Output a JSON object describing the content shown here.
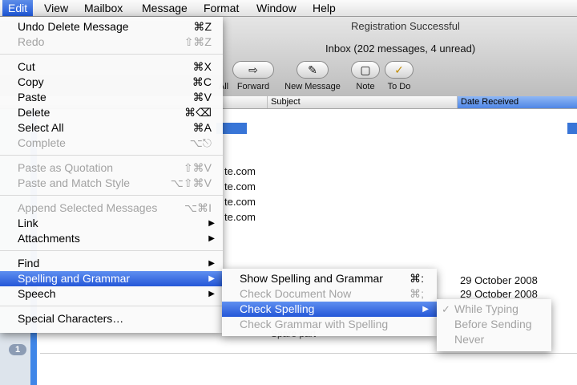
{
  "menubar": {
    "items": [
      "Edit",
      "View",
      "Mailbox",
      "Message",
      "Format",
      "Window",
      "Help"
    ]
  },
  "window": {
    "title": "Registration Successful",
    "subtitle": "Inbox (202 messages, 4 unread)",
    "toolbar": [
      {
        "label": "All",
        "icon": "reply-all-icon"
      },
      {
        "label": "Forward",
        "icon": "forward-arrow-icon",
        "glyph": "⇨"
      },
      {
        "label": "New Message",
        "icon": "compose-icon",
        "glyph": "✎"
      },
      {
        "label": "Note",
        "icon": "note-icon",
        "glyph": "▢"
      },
      {
        "label": "To Do",
        "icon": "checkmark-icon",
        "glyph": "✓"
      }
    ],
    "columns": {
      "subject": "Subject",
      "date": "Date Received"
    },
    "sidebar_badge": "1",
    "fragments": [
      "te.com",
      "te.com",
      "te.com",
      "te.com"
    ],
    "dates": [
      "29 October 2008",
      "29 October 2008"
    ],
    "bottom_fragment": "Spare part"
  },
  "edit_menu": {
    "items": [
      {
        "label": "Undo Delete Message",
        "shortcut": "⌘Z",
        "disabled": false
      },
      {
        "label": "Redo",
        "shortcut": "⇧⌘Z",
        "disabled": true
      },
      {
        "label": "Cut",
        "shortcut": "⌘X",
        "disabled": false
      },
      {
        "label": "Copy",
        "shortcut": "⌘C",
        "disabled": false
      },
      {
        "label": "Paste",
        "shortcut": "⌘V",
        "disabled": false
      },
      {
        "label": "Delete",
        "shortcut": "⌘⌫",
        "disabled": false
      },
      {
        "label": "Select All",
        "shortcut": "⌘A",
        "disabled": false
      },
      {
        "label": "Complete",
        "shortcut": "⌥⎋",
        "disabled": true
      },
      {
        "label": "Paste as Quotation",
        "shortcut": "⇧⌘V",
        "disabled": true
      },
      {
        "label": "Paste and Match Style",
        "shortcut": "⌥⇧⌘V",
        "disabled": true
      },
      {
        "label": "Append Selected Messages",
        "shortcut": "⌥⌘I",
        "disabled": true
      },
      {
        "label": "Link",
        "submenu": true,
        "disabled": false
      },
      {
        "label": "Attachments",
        "submenu": true,
        "disabled": false
      },
      {
        "label": "Find",
        "submenu": true,
        "disabled": false
      },
      {
        "label": "Spelling and Grammar",
        "submenu": true,
        "disabled": false,
        "highlighted": true
      },
      {
        "label": "Speech",
        "submenu": true,
        "disabled": false
      },
      {
        "label": "Special Characters…",
        "disabled": false
      }
    ]
  },
  "spelling_menu": {
    "items": [
      {
        "label": "Show Spelling and Grammar",
        "shortcut": "⌘:",
        "disabled": false
      },
      {
        "label": "Check Document Now",
        "shortcut": "⌘;",
        "disabled": true
      },
      {
        "label": "Check Spelling",
        "submenu": true,
        "disabled": false,
        "highlighted": true
      },
      {
        "label": "Check Grammar with Spelling",
        "disabled": true
      }
    ]
  },
  "check_spelling_menu": {
    "items": [
      {
        "label": "While Typing",
        "checked": true,
        "disabled": true
      },
      {
        "label": "Before Sending",
        "disabled": true
      },
      {
        "label": "Never",
        "disabled": true
      }
    ]
  },
  "glyphs": {
    "submenu_arrow": "▶",
    "check": "✓"
  },
  "colors": {
    "highlight": "#2457d8",
    "disabled_text": "#a3a3a3",
    "selection_row": "#3875d7"
  }
}
